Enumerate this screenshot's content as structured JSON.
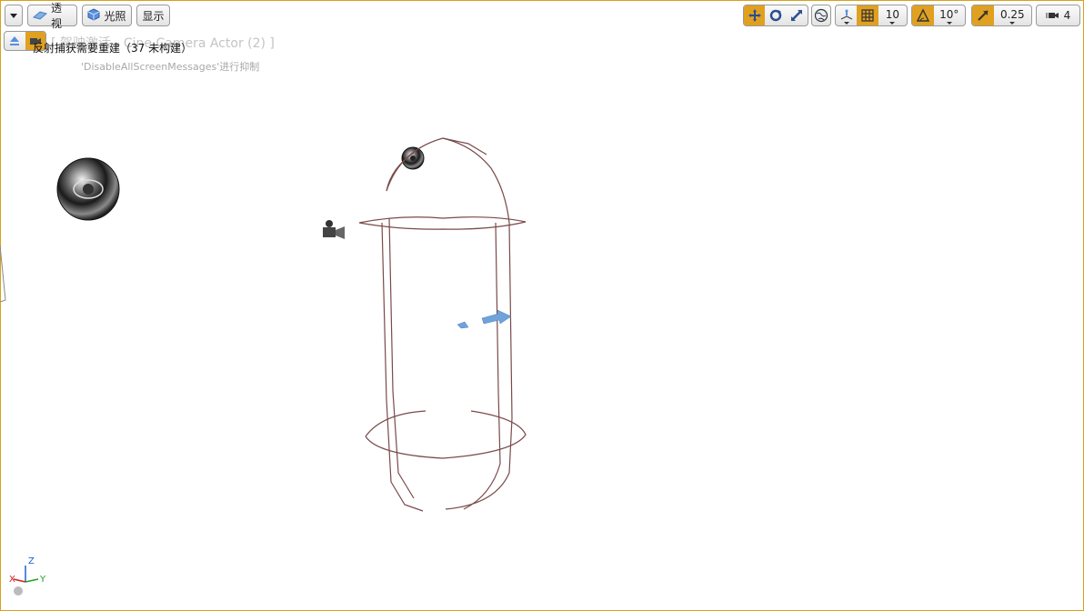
{
  "toolbar_left": {
    "perspective_label": "透视",
    "lighting_label": "光照",
    "show_label": "显示"
  },
  "toolbar_right": {
    "grid_snap_value": "10",
    "rotation_snap_value": "10°",
    "scale_snap_value": "0.25",
    "camera_speed_value": "4"
  },
  "messages": {
    "pilot_ghost": "[ 驾驶激活 - Cine Camera Actor (2) ]",
    "reflection_capture": "反射捕获需要重建（37 未构建）",
    "suppress_hint": "'DisableAllScreenMessages'进行抑制"
  },
  "axis": {
    "z": "Z",
    "x": "X",
    "y": "Y"
  },
  "colors": {
    "accent": "#e0a020",
    "capsule_wire": "#7a4a4a",
    "arrow_blue": "#6fa3d9",
    "frame_border": "#d7a11a"
  }
}
